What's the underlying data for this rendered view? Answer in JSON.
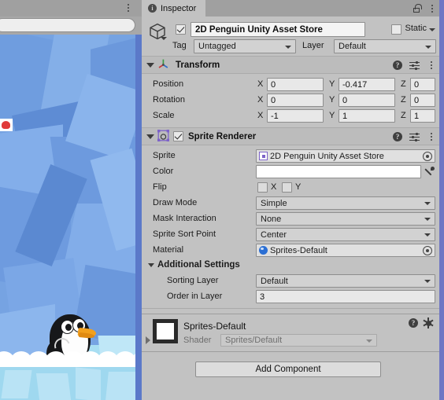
{
  "scene_panel": {
    "name": "scene-view",
    "search_placeholder": "",
    "menu_icon": "three-dot-menu-icon"
  },
  "inspector": {
    "tab": {
      "label": "Inspector",
      "icon": "info-icon"
    },
    "lock_icon": "unlocked-padlock-icon",
    "menu_icon": "three-dot-menu-icon",
    "gameobject": {
      "icon": "cube-icon",
      "active": true,
      "name": "2D Penguin Unity Asset Store",
      "static_label": "Static",
      "static_checked": false,
      "tag_label": "Tag",
      "tag_value": "Untagged",
      "layer_label": "Layer",
      "layer_value": "Default"
    },
    "transform": {
      "title": "Transform",
      "icon": "transform-axis-icon",
      "help_icon": "help-icon",
      "preset_icon": "preset-sliders-icon",
      "menu_icon": "three-dot-menu-icon",
      "rows": [
        {
          "label": "Position",
          "x": "0",
          "y": "-0.417",
          "z": "0"
        },
        {
          "label": "Rotation",
          "x": "0",
          "y": "0",
          "z": "0"
        },
        {
          "label": "Scale",
          "x": "-1",
          "y": "1",
          "z": "1"
        }
      ],
      "axis_x": "X",
      "axis_y": "Y",
      "axis_z": "Z"
    },
    "sprite_renderer": {
      "title": "Sprite Renderer",
      "icon": "sprite-renderer-icon",
      "enabled": true,
      "help_icon": "help-icon",
      "preset_icon": "preset-sliders-icon",
      "menu_icon": "three-dot-menu-icon",
      "sprite_label": "Sprite",
      "sprite_value": "2D Penguin Unity Asset Store",
      "color_label": "Color",
      "color_value": "#FFFFFF",
      "flip_label": "Flip",
      "flip_x_label": "X",
      "flip_y_label": "Y",
      "flip_x": false,
      "flip_y": false,
      "draw_mode_label": "Draw Mode",
      "draw_mode_value": "Simple",
      "mask_interaction_label": "Mask Interaction",
      "mask_interaction_value": "None",
      "sort_point_label": "Sprite Sort Point",
      "sort_point_value": "Center",
      "material_label": "Material",
      "material_value": "Sprites-Default",
      "additional_settings_label": "Additional Settings",
      "sorting_layer_label": "Sorting Layer",
      "sorting_layer_value": "Default",
      "order_in_layer_label": "Order in Layer",
      "order_in_layer_value": "3"
    },
    "material_preview": {
      "name": "Sprites-Default",
      "shader_label": "Shader",
      "shader_value": "Sprites/Default",
      "help_icon": "help-icon",
      "gear_icon": "gear-icon"
    },
    "add_component_label": "Add Component"
  },
  "colors": {
    "panel_bg": "#c2c2c2",
    "header_bg": "#bcbcbc",
    "tabbar_bg": "#a0a0a0",
    "accent_strip": "#6f76c4",
    "sprite_icon": "#7d63c8",
    "material_icon": "#2b6fd4",
    "scene_ice": "#76a3e2"
  }
}
